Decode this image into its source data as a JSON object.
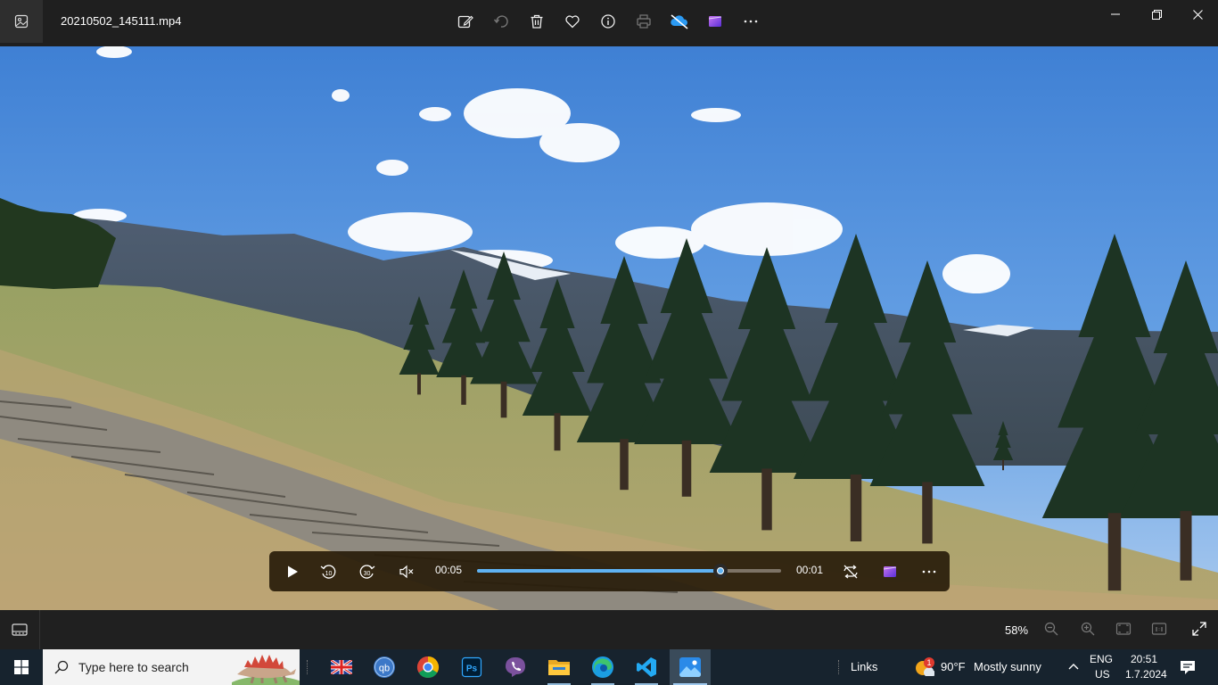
{
  "window": {
    "filename": "20210502_145111.mp4",
    "toolbar": [
      {
        "name": "edit-image-icon"
      },
      {
        "name": "rotate-icon"
      },
      {
        "name": "delete-icon"
      },
      {
        "name": "favorite-heart-icon"
      },
      {
        "name": "info-icon"
      },
      {
        "name": "print-icon"
      },
      {
        "name": "onedrive-offline-icon"
      },
      {
        "name": "clipchamp-icon"
      },
      {
        "name": "more-options-icon"
      }
    ],
    "controls": [
      "minimize-icon",
      "restore-icon",
      "close-icon"
    ]
  },
  "player": {
    "current_time": "00:05",
    "remaining_time": "00:01",
    "progress": 0.8,
    "buttons": [
      "play-icon",
      "rewind-10-icon",
      "forward-30-icon",
      "mute-icon",
      "repeat-off-icon",
      "clipchamp-icon",
      "more-icon"
    ],
    "rewind_label": "10",
    "forward_label": "30"
  },
  "statusbar": {
    "zoom": "58%"
  },
  "taskbar": {
    "search_placeholder": "Type here to search",
    "apps": [
      "english-uk-flag-icon",
      "qbittorrent-icon",
      "chrome-icon",
      "photoshop-icon",
      "viber-icon",
      "file-explorer-icon",
      "edge-icon",
      "vscode-icon",
      "photos-icon"
    ],
    "qb_label": "qb",
    "ps_label": "Ps",
    "links_label": "Links",
    "weather": {
      "badge": "1",
      "temp": "90°F",
      "condition": "Mostly sunny"
    },
    "lang_top": "ENG",
    "lang_bottom": "US",
    "time": "20:51",
    "date": "1.7.2024"
  },
  "colors": {
    "titlebar": "#1f1f1f",
    "accent": "#5fb2f2",
    "taskbar": "#17232e"
  }
}
